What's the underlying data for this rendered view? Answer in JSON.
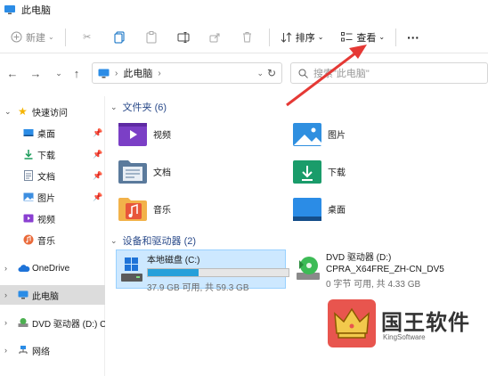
{
  "window": {
    "title": "此电脑"
  },
  "toolbar": {
    "new_label": "新建",
    "sort_label": "排序",
    "view_label": "查看",
    "more_label": "···"
  },
  "address": {
    "crumb": "此电脑",
    "search_placeholder": "搜索\"此电脑\""
  },
  "sidebar": {
    "quick_access": "快速访问",
    "items": [
      {
        "label": "桌面",
        "icon": "desktop-icon",
        "pinned": true
      },
      {
        "label": "下载",
        "icon": "download-icon",
        "pinned": true
      },
      {
        "label": "文档",
        "icon": "document-icon",
        "pinned": true
      },
      {
        "label": "图片",
        "icon": "picture-icon",
        "pinned": true
      },
      {
        "label": "视频",
        "icon": "video-icon",
        "pinned": false
      },
      {
        "label": "音乐",
        "icon": "music-icon",
        "pinned": false
      }
    ],
    "onedrive": "OneDrive",
    "this_pc": "此电脑",
    "dvd": "DVD 驱动器 (D:) CI",
    "network": "网络"
  },
  "main": {
    "folders_header": "文件夹 (6)",
    "folders": [
      {
        "label": "视频",
        "icon": "video-folder-icon"
      },
      {
        "label": "图片",
        "icon": "picture-folder-icon"
      },
      {
        "label": "文档",
        "icon": "document-folder-icon"
      },
      {
        "label": "下载",
        "icon": "download-folder-icon"
      },
      {
        "label": "音乐",
        "icon": "music-folder-icon"
      },
      {
        "label": "桌面",
        "icon": "desktop-folder-icon"
      }
    ],
    "drives_header": "设备和驱动器 (2)",
    "drives": [
      {
        "name": "本地磁盘 (C:)",
        "size": "37.9 GB 可用, 共 59.3 GB",
        "used_fraction": 0.36
      },
      {
        "name": "DVD 驱动器 (D:)",
        "label2": "CPRA_X64FRE_ZH-CN_DV5",
        "size": "0 字节 可用, 共 4.33 GB"
      }
    ]
  },
  "watermark": {
    "title": "国王软件",
    "subtitle": "KingSoftware"
  },
  "colors": {
    "accent": "#0067c0",
    "folder_header": "#2a4a8a",
    "annotation_arrow": "#e53935",
    "drive_fill": "#26a0da"
  }
}
